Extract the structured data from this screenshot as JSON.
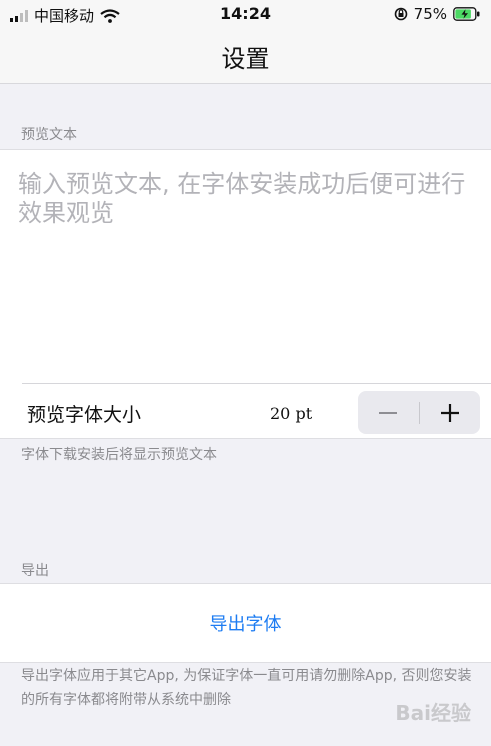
{
  "status_bar": {
    "carrier": "中国移动",
    "time": "14:24",
    "battery": "75%"
  },
  "nav": {
    "title": "设置"
  },
  "preview_section": {
    "header": "预览文本",
    "input_placeholder": "输入预览文本, 在字体安装成功后便可进行效果观览",
    "size_label": "预览字体大小",
    "size_value": "20 pt",
    "decrease_icon": "minus-icon",
    "increase_icon": "plus-icon",
    "footnote": "字体下载安装后将显示预览文本"
  },
  "export_section": {
    "header": "导出",
    "button_label": "导出字体",
    "footnote": "导出字体应用于其它App, 为保证字体一直可用请勿删除App, 否则您安装的所有字体都将附带从系统中删除"
  },
  "watermark": "Bai经验",
  "colors": {
    "accent": "#1d7cf2",
    "background": "#f1f1f6",
    "battery": "#4cd964"
  }
}
